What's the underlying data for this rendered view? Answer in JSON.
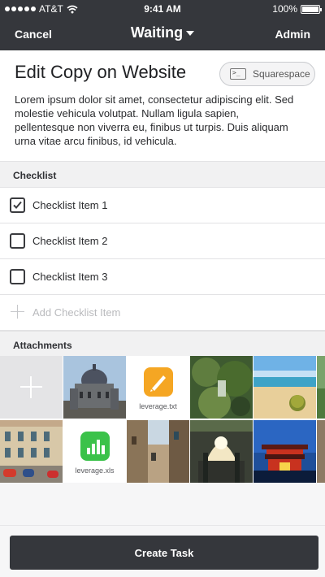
{
  "status_bar": {
    "carrier": "AT&T",
    "time": "9:41 AM",
    "battery": "100%"
  },
  "nav": {
    "cancel_label": "Cancel",
    "title": "Waiting",
    "admin_label": "Admin"
  },
  "task": {
    "title": "Edit Copy on Website",
    "tag": {
      "label": "Squarespace",
      "icon": "terminal-icon"
    },
    "description": "Lorem ipsum dolor sit amet, consectetur adipiscing elit. Sed molestie vehicula volutpat. Nullam ligula sapien, pellentesque non viverra eu, finibus ut turpis. Duis aliquam urna vitae arcu finibus, id vehicula."
  },
  "checklist": {
    "heading": "Checklist",
    "items": [
      {
        "label": "Checklist Item 1",
        "checked": true
      },
      {
        "label": "Checklist Item 2",
        "checked": false
      },
      {
        "label": "Checklist Item 3",
        "checked": false
      }
    ],
    "add_label": "Add Checklist Item"
  },
  "attachments": {
    "heading": "Attachments",
    "files": [
      {
        "name": "leverage.txt",
        "icon": "pages-app-icon",
        "color": "#f5a623"
      },
      {
        "name": "leverage.xls",
        "icon": "numbers-app-icon",
        "color": "#3bc24a"
      }
    ]
  },
  "footer": {
    "create_label": "Create Task"
  },
  "colors": {
    "dark": "#35373c",
    "section_bg": "#f1f1f2",
    "divider": "#e2e2e4"
  }
}
